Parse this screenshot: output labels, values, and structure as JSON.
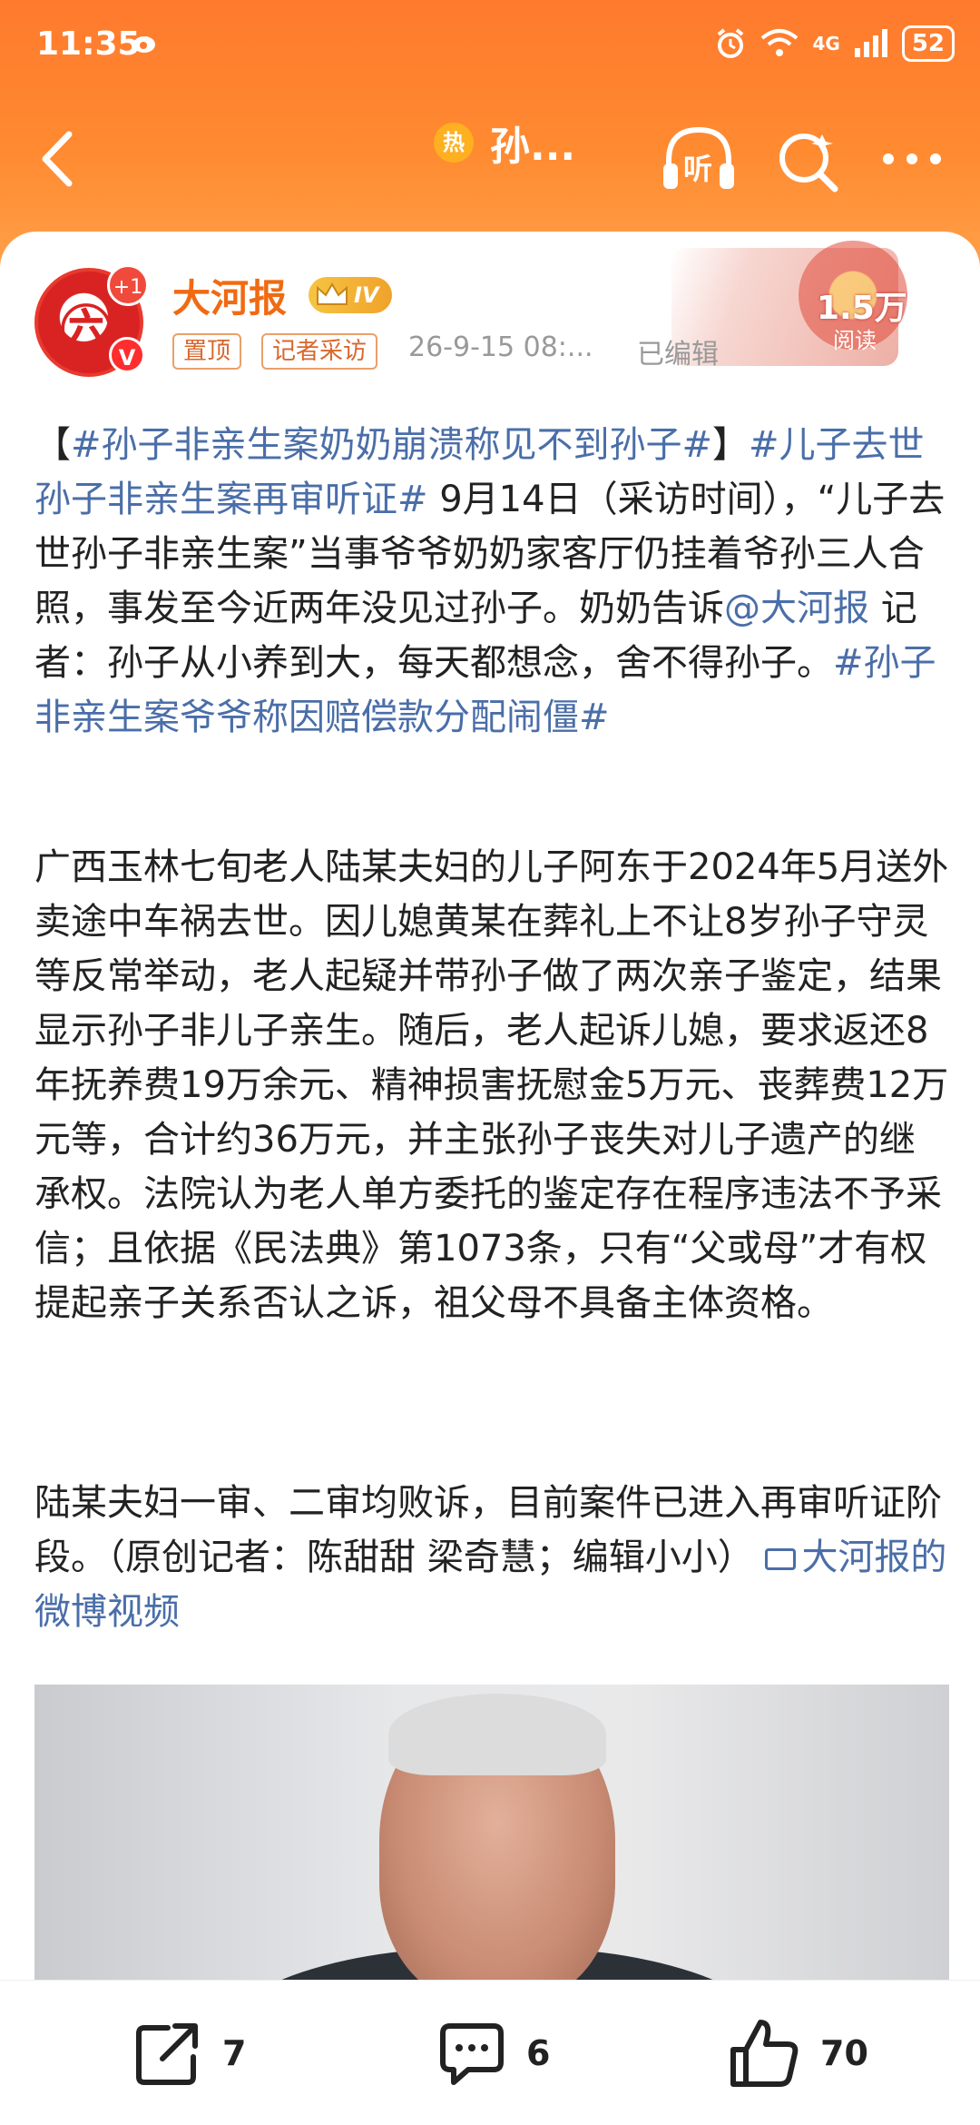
{
  "status_bar": {
    "time": "11:35",
    "network": "4G",
    "battery": "52"
  },
  "nav": {
    "hot_badge": "热",
    "title": "孙...",
    "listen_label": "听"
  },
  "post": {
    "author": "大河报",
    "level": "IV",
    "avatar_plus": "+1",
    "avatar_v": "V",
    "tags": [
      "置顶",
      "记者采访"
    ],
    "time": "26-9-15 08:...",
    "edited": "已编辑",
    "reads_count": "1.5万",
    "reads_label": "阅读",
    "p1_a": "【",
    "p1_tag1": "#孙子非亲生案奶奶崩溃称见不到孙子#",
    "p1_b": "】",
    "p1_tag2": "#儿子去世孙子非亲生案再审听证#",
    "p1_c": " 9月14日（采访时间），“儿子去世孙子非亲生案”当事爷爷奶奶家客厅仍挂着爷孙三人合照，事发至今近两年没见过孙子。奶奶告诉",
    "p1_mention": "@大河报",
    "p1_d": " 记者：孙子从小养到大，每天都想念，舍不得孙子。",
    "p1_tag3": "#孙子非亲生案爷爷称因赔偿款分配闹僵#",
    "p2": "广西玉林七旬老人陆某夫妇的儿子阿东于2024年5月送外卖途中车祸去世。因儿媳黄某在葬礼上不让8岁孙子守灵等反常举动，老人起疑并带孙子做了两次亲子鉴定，结果显示孙子非儿子亲生。随后，老人起诉儿媳，要求返还8年抚养费19万余元、精神损害抚慰金5万元、丧葬费12万元等，合计约36万元，并主张孙子丧失对儿子遗产的继承权。法院认为老人单方委托的鉴定存在程序违法不予采信；且依据《民法典》第1073条，只有“父或母”才有权提起亲子关系否认之诉，祖父母不具备主体资格。",
    "p3": "陆某夫妇一审、二审均败诉，目前案件已进入再审听证阶段。（原创记者：陈甜甜 梁奇慧；编辑小小）",
    "video_link": "大河报的微博视频"
  },
  "actions": {
    "share_count": "7",
    "comment_count": "6",
    "like_count": "70"
  },
  "colors": {
    "header_orange": "#ff7a2e",
    "author_orange": "#f06a12",
    "link_blue": "#4a6ea8"
  }
}
